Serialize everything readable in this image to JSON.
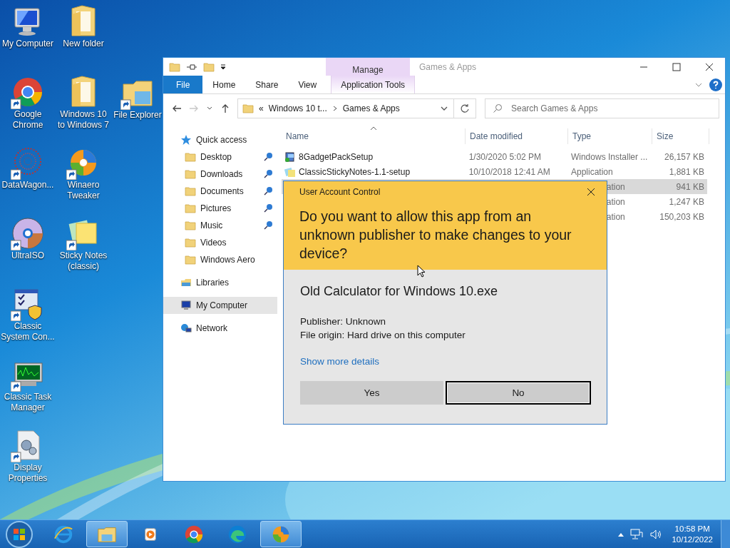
{
  "desktop": {
    "columns": [
      [
        {
          "label": "My Computer",
          "kind": "computer",
          "shortcut": false
        },
        {
          "label": "Google Chrome",
          "kind": "chrome",
          "shortcut": true
        },
        {
          "label": "DataWagon...",
          "kind": "dots",
          "shortcut": true
        },
        {
          "label": "UltraISO",
          "kind": "disc",
          "shortcut": true
        },
        {
          "label": "Classic System Con...",
          "kind": "control",
          "shortcut": true
        },
        {
          "label": "Classic Task Manager",
          "kind": "monitor",
          "shortcut": true
        },
        {
          "label": "Display Properties",
          "kind": "gears",
          "shortcut": true
        }
      ],
      [
        {
          "label": "New folder",
          "kind": "folder",
          "shortcut": false
        },
        {
          "label": "Windows 10 to Windows 7",
          "kind": "folder",
          "shortcut": false
        },
        {
          "label": "Winaero Tweaker",
          "kind": "swirl",
          "shortcut": true
        },
        {
          "label": "Sticky Notes (classic)",
          "kind": "notes",
          "shortcut": true
        }
      ],
      [
        {
          "label": "File Explorer",
          "kind": "explorer",
          "shortcut": true
        }
      ]
    ]
  },
  "explorer": {
    "title": "Games & Apps",
    "context_tab": "Manage",
    "tabs": [
      {
        "label": "File",
        "kind": "file",
        "selected": false
      },
      {
        "label": "Home",
        "kind": "plain",
        "selected": false
      },
      {
        "label": "Share",
        "kind": "plain",
        "selected": false
      },
      {
        "label": "View",
        "kind": "plain",
        "selected": false
      },
      {
        "label": "Application Tools",
        "kind": "context",
        "selected": false
      }
    ],
    "address": {
      "overflow": "«",
      "crumbs": [
        "Windows 10 t...",
        "Games & Apps"
      ]
    },
    "forward_disabled": true,
    "search": {
      "placeholder": "Search Games & Apps"
    },
    "nav": [
      {
        "label": "Quick access",
        "kind": "star",
        "selected": false,
        "children": [
          {
            "label": "Desktop",
            "pinned": true,
            "selected": false
          },
          {
            "label": "Downloads",
            "pinned": true,
            "selected": false
          },
          {
            "label": "Documents",
            "pinned": true,
            "selected": false
          },
          {
            "label": "Pictures",
            "pinned": true,
            "selected": false
          },
          {
            "label": "Music",
            "pinned": true,
            "selected": false
          },
          {
            "label": "Videos",
            "pinned": false,
            "selected": false
          },
          {
            "label": "Windows Aero",
            "pinned": false,
            "selected": false
          }
        ]
      },
      {
        "label": "Libraries",
        "kind": "library",
        "selected": false
      },
      {
        "label": "My Computer",
        "kind": "computer",
        "selected": true
      },
      {
        "label": "Network",
        "kind": "network",
        "selected": false
      }
    ],
    "columns": [
      "Name",
      "Date modified",
      "Type",
      "Size"
    ],
    "rows": [
      {
        "name": "8GadgetPackSetup",
        "kind": "installer",
        "date": "1/30/2020 5:02 PM",
        "type": "Windows Installer ...",
        "size": "26,157 KB",
        "selected": false,
        "covered": false
      },
      {
        "name": "ClassicStickyNotes-1.1-setup",
        "kind": "app",
        "date": "10/10/2018 12:41 AM",
        "type": "Application",
        "size": "1,881 KB",
        "selected": false,
        "covered": false
      },
      {
        "type": "ation",
        "size": "941 KB",
        "selected": true,
        "covered": true
      },
      {
        "type": "ation",
        "size": "1,247 KB",
        "selected": false,
        "covered": true
      },
      {
        "type": "ation",
        "size": "150,203 KB",
        "selected": false,
        "covered": true
      }
    ]
  },
  "uac": {
    "title": "User Account Control",
    "question": "Do you want to allow this app from an unknown publisher to make changes to your device?",
    "app": "Old Calculator for Windows 10.exe",
    "publisher": "Publisher: Unknown",
    "origin": "File origin: Hard drive on this computer",
    "details_link": "Show more details",
    "buttons": [
      {
        "label": "Yes",
        "focused": false
      },
      {
        "label": "No",
        "focused": true
      }
    ]
  },
  "taskbar": {
    "apps": [
      {
        "kind": "ie",
        "active": false
      },
      {
        "kind": "explorer",
        "active": true
      },
      {
        "kind": "media",
        "active": false
      },
      {
        "kind": "chrome",
        "active": false
      },
      {
        "kind": "edge",
        "active": false
      },
      {
        "kind": "swirl",
        "active": true
      }
    ],
    "time": "10:58 PM",
    "date": "10/12/2022"
  }
}
